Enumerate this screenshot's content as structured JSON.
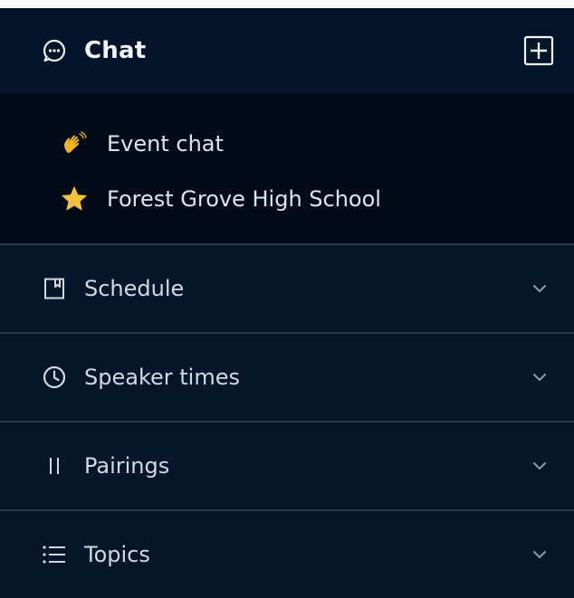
{
  "chat": {
    "title": "Chat",
    "icon": "chat-bubble-icon",
    "add_icon": "plus-square-icon",
    "items": [
      {
        "label": "Event chat",
        "icon": "waving-hand-icon"
      },
      {
        "label": "Forest Grove High School",
        "icon": "star-icon"
      }
    ]
  },
  "sections": [
    {
      "label": "Schedule",
      "icon": "bookmark-icon"
    },
    {
      "label": "Speaker times",
      "icon": "clock-icon"
    },
    {
      "label": "Pairings",
      "icon": "pause-icon"
    },
    {
      "label": "Topics",
      "icon": "list-icon"
    }
  ],
  "colors": {
    "panel_bg": "#05162b",
    "chat_list_bg": "#020c19",
    "divider": "#2a3a4e",
    "text": "#dfe4ec"
  }
}
